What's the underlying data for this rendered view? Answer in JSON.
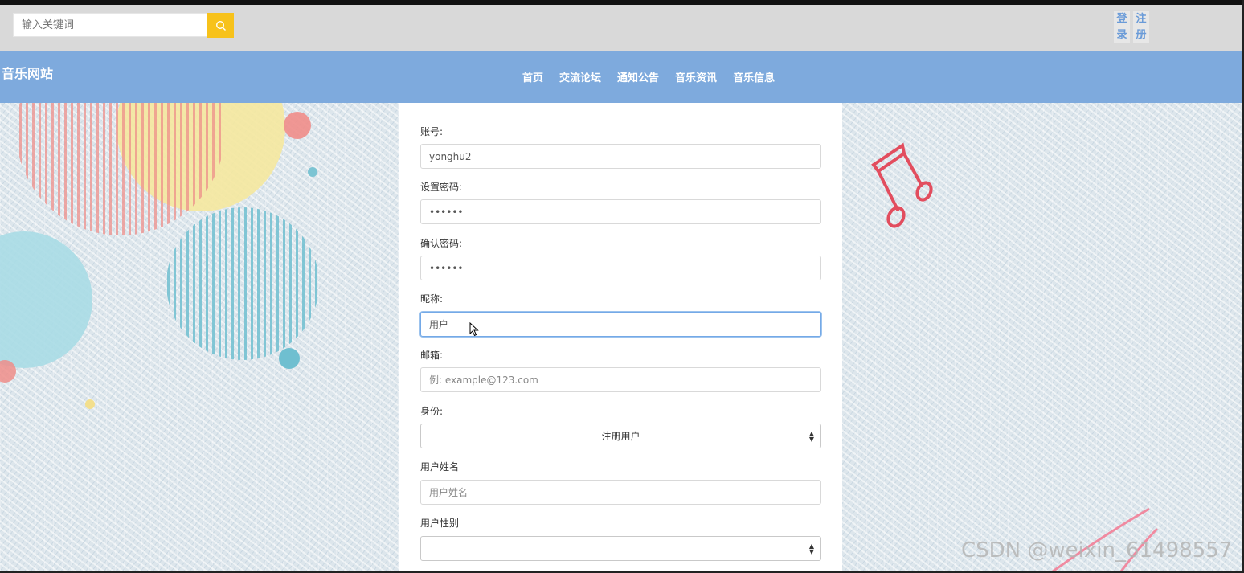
{
  "search": {
    "placeholder": "输入关键词"
  },
  "auth": {
    "login_label": "登录",
    "register_label": "注册"
  },
  "site": {
    "title": "音乐网站"
  },
  "nav": {
    "items": [
      "首页",
      "交流论坛",
      "通知公告",
      "音乐资讯",
      "音乐信息"
    ]
  },
  "form": {
    "account": {
      "label": "账号:",
      "value": "yonghu2"
    },
    "password": {
      "label": "设置密码:",
      "value": "••••••"
    },
    "confirm_password": {
      "label": "确认密码:",
      "value": "••••••"
    },
    "nickname": {
      "label": "昵称:",
      "value": "用户"
    },
    "email": {
      "label": "邮箱:",
      "value": "",
      "placeholder": "例: example@123.com"
    },
    "identity": {
      "label": "身份:",
      "selected": "注册用户"
    },
    "real_name": {
      "label": "用户姓名",
      "value": "",
      "placeholder": "用户姓名"
    },
    "gender": {
      "label": "用户性别",
      "selected": ""
    }
  },
  "watermark": "CSDN @weixin_61498557",
  "colors": {
    "navbar": "#7eaadd",
    "search_button": "#f7c21b",
    "auth_link": "#6a9bd8"
  }
}
